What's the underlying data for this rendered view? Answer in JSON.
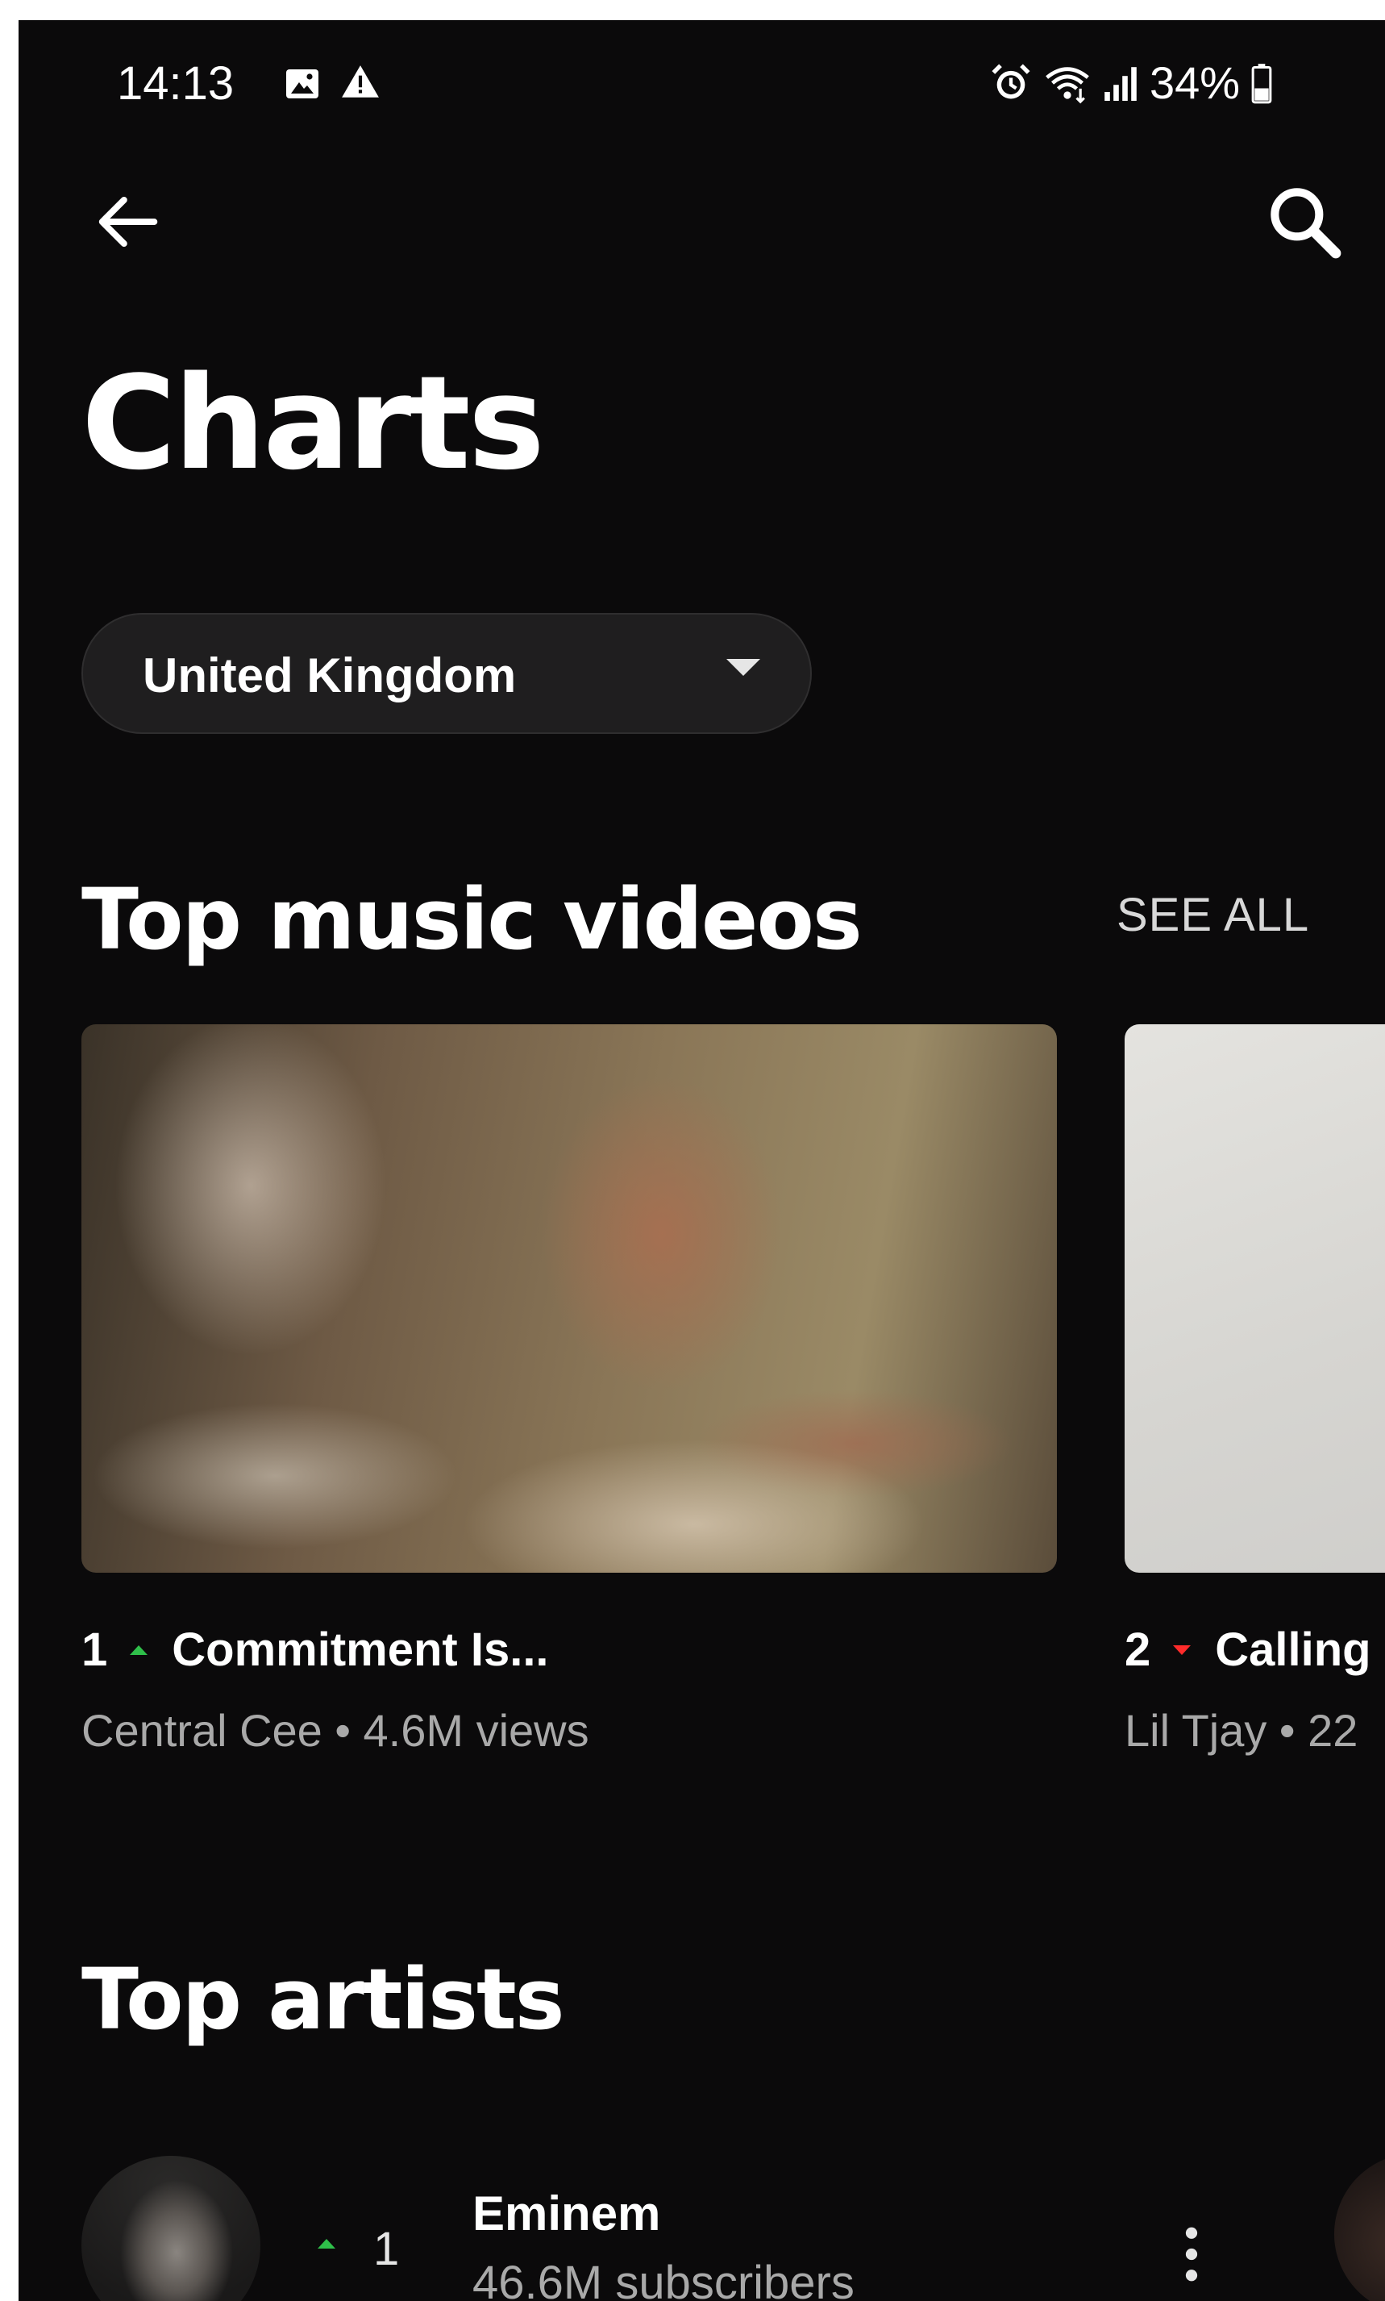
{
  "status_bar": {
    "time": "14:13",
    "battery": "34%",
    "left_icons": [
      "gallery-icon",
      "warning-icon"
    ],
    "right_icons": [
      "alarm-icon",
      "wifi-icon",
      "signal-icon",
      "battery-icon"
    ]
  },
  "header": {
    "back_icon": "arrow-back-icon",
    "search_icon": "search-icon",
    "title": "Charts"
  },
  "country_select": {
    "value": "United Kingdom",
    "icon": "caret-down-icon"
  },
  "top_music_videos": {
    "title": "Top music videos",
    "see_all": "SEE ALL",
    "items": [
      {
        "rank": "1",
        "trend": "up",
        "title": "Commitment Is...",
        "meta": "Central Cee • 4.6M views"
      },
      {
        "rank": "2",
        "trend": "down",
        "title": "Calling",
        "meta": "Lil Tjay • 22"
      }
    ]
  },
  "top_artists": {
    "title": "Top artists",
    "items": [
      {
        "rank": "1",
        "trend": "up",
        "name": "Eminem",
        "subscribers": "46.6M subscribers",
        "menu_icon": "more-vert-icon"
      }
    ]
  },
  "colors": {
    "background": "#0b0a0b",
    "trend_up": "#2fbf4a",
    "trend_down": "#ff2b2b",
    "secondary_text": "#a9a9a9"
  }
}
